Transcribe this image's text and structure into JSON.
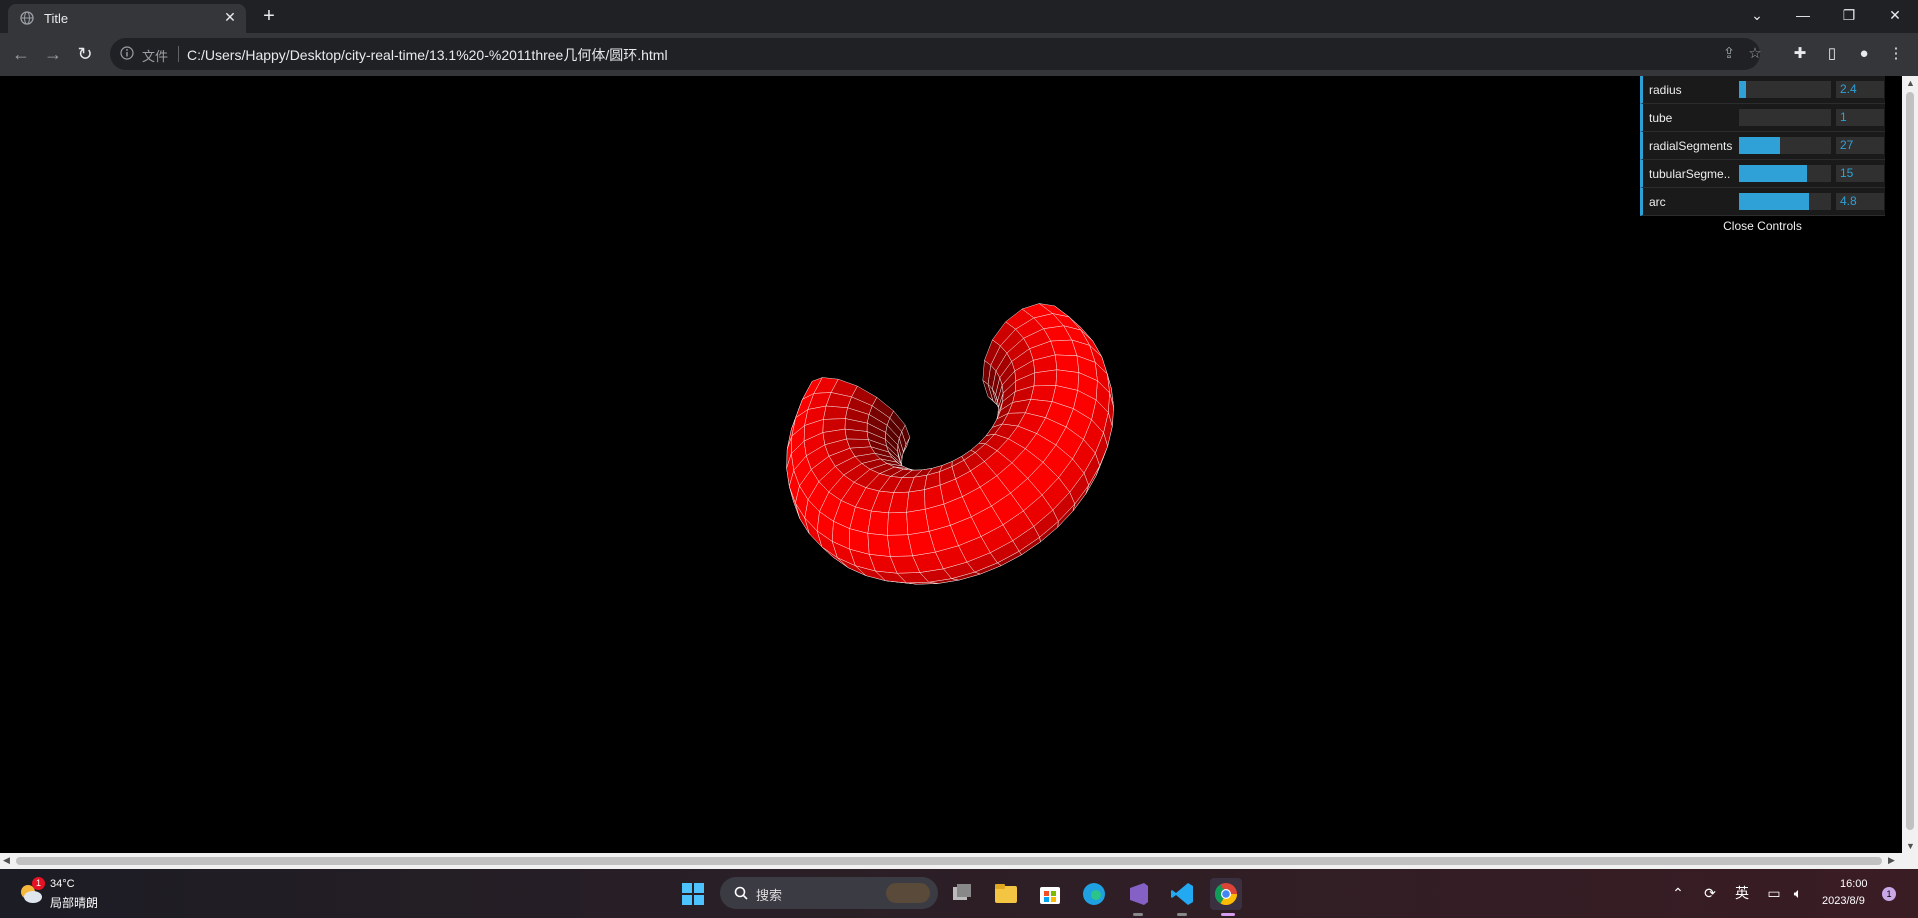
{
  "browser": {
    "tab_title": "Title",
    "tab_close": "✕",
    "new_tab": "+",
    "scheme_label": "文件",
    "url": "C:/Users/Happy/Desktop/city-real-time/13.1%20-%2011three几何体/圆环.html"
  },
  "gui": {
    "controls": [
      {
        "label": "radius",
        "value": "2.4",
        "fill": 0.08
      },
      {
        "label": "tube",
        "value": "1",
        "fill": 0.0
      },
      {
        "label": "radialSegments",
        "value": "27",
        "fill": 0.45
      },
      {
        "label": "tubularSegme..",
        "value": "15",
        "fill": 0.74
      },
      {
        "label": "arc",
        "value": "4.8",
        "fill": 0.76
      }
    ],
    "close_label": "Close Controls",
    "accent": "#2fa1d6"
  },
  "scene": {
    "object": "torus",
    "color": "#ff0000",
    "wireframe_color": "#ffffff"
  },
  "taskbar": {
    "weather_temp": "34°C",
    "weather_desc": "局部晴朗",
    "weather_badge": "1",
    "search_label": "搜索",
    "ime_label": "英",
    "clock_time": "16:00",
    "clock_date": "2023/8/9",
    "notification_count": "1"
  }
}
